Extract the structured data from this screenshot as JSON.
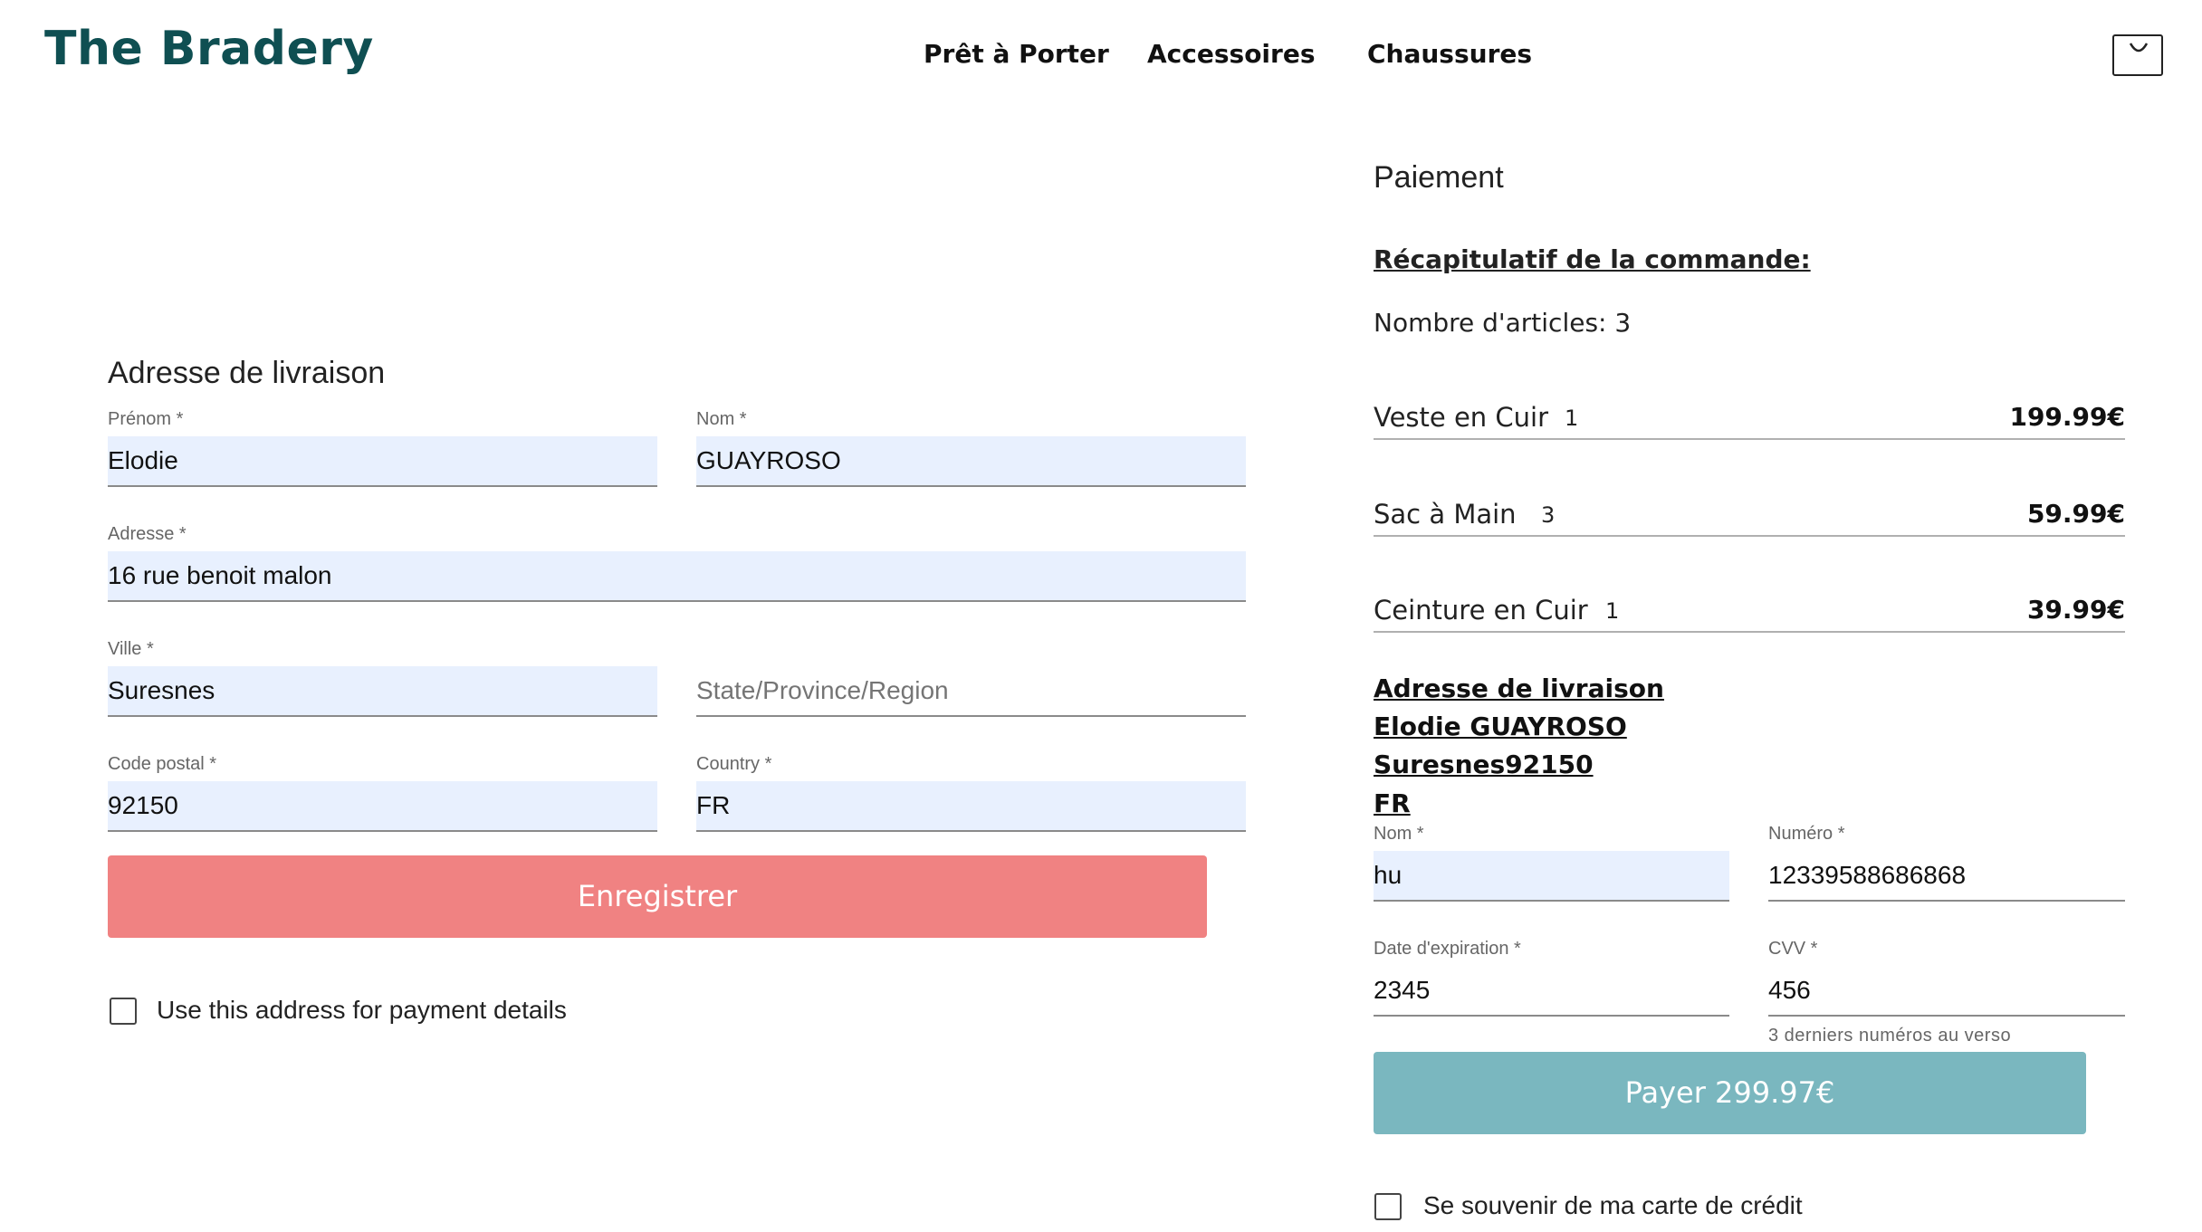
{
  "header": {
    "logo": "The Bradery",
    "nav": [
      "Prêt à Porter",
      "Accessoires",
      "Chaussures"
    ],
    "cart_icon": "shopping-bag-icon"
  },
  "shipping": {
    "title": "Adresse de livraison",
    "fields": {
      "first_name": {
        "label": "Prénom *",
        "value": "Elodie"
      },
      "last_name": {
        "label": "Nom *",
        "value": "GUAYROSO"
      },
      "address": {
        "label": "Adresse *",
        "value": "16 rue benoit malon"
      },
      "city": {
        "label": "Ville *",
        "value": "Suresnes"
      },
      "region": {
        "label": "",
        "placeholder": "State/Province/Region",
        "value": ""
      },
      "postal": {
        "label": "Code postal *",
        "value": "92150"
      },
      "country": {
        "label": "Country *",
        "value": "FR"
      }
    },
    "save_label": "Enregistrer",
    "use_address_label": "Use this address for payment details"
  },
  "payment": {
    "title": "Paiement",
    "summary_heading": "Récapitulatif de la commande:",
    "item_count": "Nombre d'articles: 3",
    "items": [
      {
        "name": "Veste en Cuir",
        "qty": "1",
        "price": "199.99€"
      },
      {
        "name": "Sac à Main",
        "qty": "3",
        "price": "59.99€"
      },
      {
        "name": "Ceinture en Cuir",
        "qty": "1",
        "price": "39.99€"
      }
    ],
    "address_summary": {
      "heading": "Adresse de livraison",
      "name": "Elodie GUAYROSO",
      "city_postal": "Suresnes92150",
      "country": "FR"
    },
    "card": {
      "name": {
        "label": "Nom *",
        "value": "hu"
      },
      "number": {
        "label": "Numéro *",
        "value": "12339588686868"
      },
      "expiry": {
        "label": "Date d'expiration *",
        "value": "2345"
      },
      "cvv": {
        "label": "CVV *",
        "value": "456"
      },
      "cvv_helper": "3 derniers numéros au verso"
    },
    "pay_label": "Payer 299.97€",
    "remember_label": "Se souvenir de ma carte de crédit"
  },
  "colors": {
    "brand": "#0f4f52",
    "save_button": "#f08282",
    "pay_button": "#7ab7bf",
    "autofill": "#e8f0fe"
  }
}
